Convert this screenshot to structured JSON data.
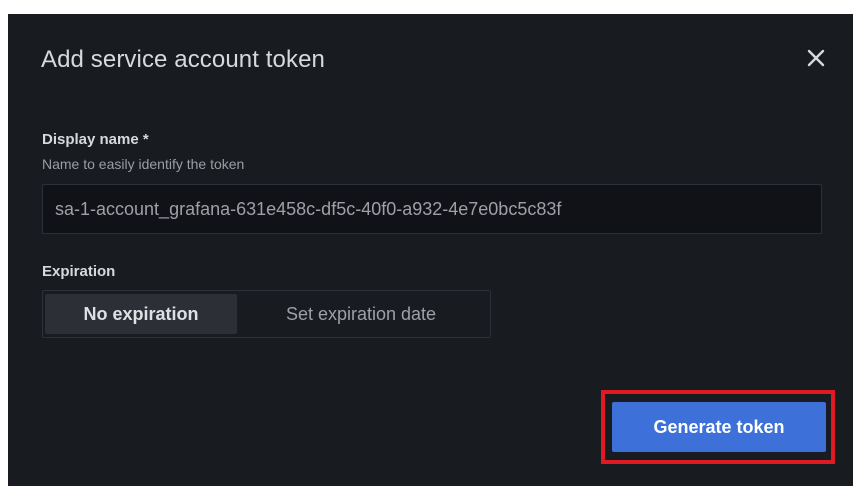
{
  "modal": {
    "title": "Add service account token",
    "close_icon": "close-icon"
  },
  "display_name": {
    "label": "Display name *",
    "description": "Name to easily identify the token",
    "value": "sa-1-account_grafana-631e458c-df5c-40f0-a932-4e7e0bc5c83f"
  },
  "expiration": {
    "label": "Expiration",
    "options": [
      "No expiration",
      "Set expiration date"
    ],
    "selected": "No expiration"
  },
  "actions": {
    "generate_label": "Generate token"
  },
  "colors": {
    "modal_bg": "#181b1f",
    "primary": "#3d71d9",
    "highlight": "#e01a22"
  }
}
